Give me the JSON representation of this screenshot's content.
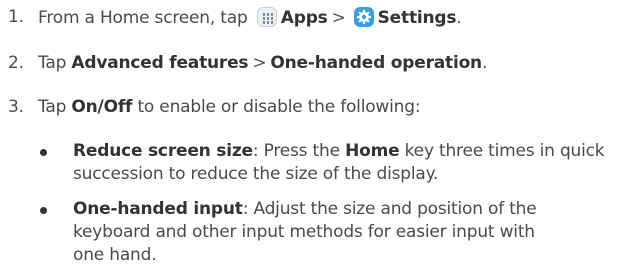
{
  "steps": [
    {
      "number": "1.",
      "prefix": "From a Home screen, tap",
      "apps_label": "Apps",
      "separator": ">",
      "settings_label": "Settings",
      "suffix": "."
    },
    {
      "number": "2.",
      "prefix": "Tap",
      "item1": "Advanced features",
      "separator": ">",
      "item2": "One-handed operation",
      "suffix": "."
    },
    {
      "number": "3.",
      "prefix": "Tap",
      "item": "On/Off",
      "suffix": "to enable or disable the following:"
    }
  ],
  "bullets": [
    {
      "term": "Reduce screen size",
      "line1_pre": ": Press the",
      "home_key": "Home",
      "line1_post": "key three times in quick",
      "line2": "succession to reduce the size of the display."
    },
    {
      "term": "One-handed input",
      "line1_rest": ": Adjust the size and position of the",
      "line2": "keyboard and other input methods for easier input with",
      "line3": "one hand."
    }
  ],
  "icons": {
    "apps": "apps-grid-icon",
    "settings": "settings-gear-icon"
  },
  "colors": {
    "text": "#4a4a4a",
    "bold": "#333333",
    "settings_icon": "#3aa0e6"
  }
}
